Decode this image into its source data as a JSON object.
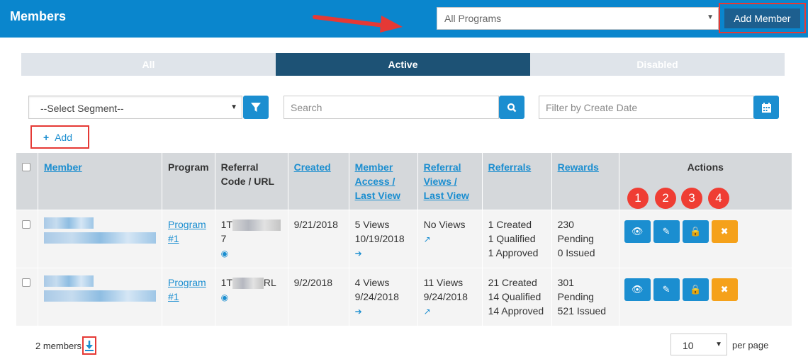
{
  "header": {
    "title": "Members",
    "program_select": "All Programs",
    "add_member": "Add Member"
  },
  "tabs": [
    {
      "label": "All"
    },
    {
      "label": "Active"
    },
    {
      "label": "Disabled"
    }
  ],
  "filters": {
    "segment": "--Select Segment--",
    "search_placeholder": "Search",
    "date_placeholder": "Filter by Create Date",
    "add_label": "Add"
  },
  "columns": {
    "member": "Member",
    "program": "Program",
    "referral_code": "Referral Code / URL",
    "created": "Created",
    "access": "Member Access / Last View",
    "views": "Referral Views / Last View",
    "referrals": "Referrals",
    "rewards": "Rewards",
    "actions": "Actions"
  },
  "rows": [
    {
      "program": "Program #1",
      "code_start": "1T",
      "code_end": "7",
      "created": "9/21/2018",
      "access_views": "5 Views",
      "access_date": "10/19/2018",
      "ref_views": "No Views",
      "ref_date": "",
      "ref_created": "1 Created",
      "ref_qualified": "1 Qualified",
      "ref_approved": "1 Approved",
      "rew_pending": "230 Pending",
      "rew_issued": "0 Issued"
    },
    {
      "program": "Program #1",
      "code_start": "1T",
      "code_end": "RL",
      "created": "9/2/2018",
      "access_views": "4 Views",
      "access_date": "9/24/2018",
      "ref_views": "11 Views",
      "ref_date": "9/24/2018",
      "ref_created": "21 Created",
      "ref_qualified": "14 Qualified",
      "ref_approved": "14 Approved",
      "rew_pending": "301 Pending",
      "rew_issued": "521 Issued"
    }
  ],
  "badges": [
    "1",
    "2",
    "3",
    "4"
  ],
  "footer": {
    "count": "2 members",
    "per_page_value": "10",
    "per_page_label": "per page"
  }
}
